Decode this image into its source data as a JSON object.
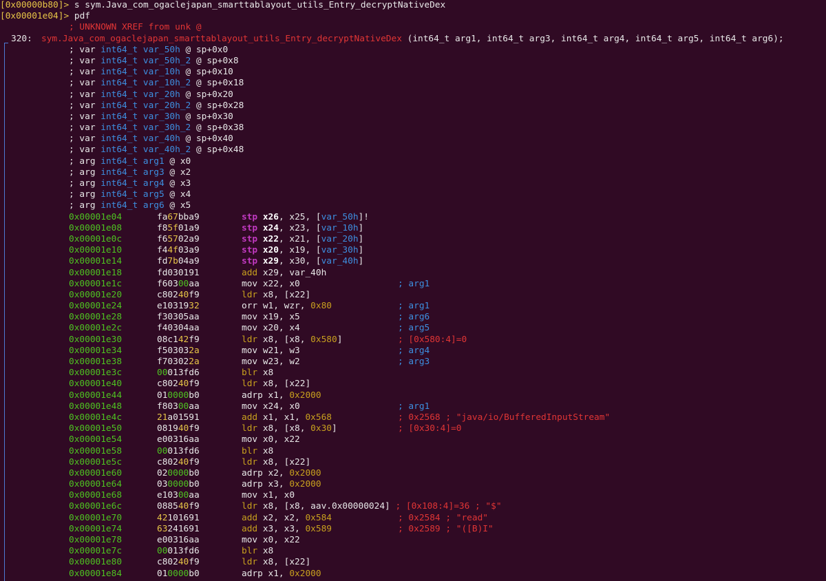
{
  "prompt1": {
    "addr": "[0x00000b80]>",
    "cmd": " s sym.Java_com_ogaclejapan_smarttablayout_utils_Entry_decryptNativeDex"
  },
  "prompt2": {
    "addr": "[0x00001e04]>",
    "cmd": " pdf"
  },
  "xref": "; UNKNOWN XREF from unk @",
  "func": {
    "size": "320:",
    "name": "sym.Java_com_ogaclejapan_smarttablayout_utils_Entry_decryptNativeDex",
    "sig": " (int64_t arg1, int64_t arg3, int64_t arg4, int64_t arg5, int64_t arg6);"
  },
  "vars": [
    {
      "kind": "; var ",
      "type": "int64_t",
      "name": "var_50h",
      "loc": "sp+0x0"
    },
    {
      "kind": "; var ",
      "type": "int64_t",
      "name": "var_50h_2",
      "loc": "sp+0x8"
    },
    {
      "kind": "; var ",
      "type": "int64_t",
      "name": "var_10h",
      "loc": "sp+0x10"
    },
    {
      "kind": "; var ",
      "type": "int64_t",
      "name": "var_10h_2",
      "loc": "sp+0x18"
    },
    {
      "kind": "; var ",
      "type": "int64_t",
      "name": "var_20h",
      "loc": "sp+0x20"
    },
    {
      "kind": "; var ",
      "type": "int64_t",
      "name": "var_20h_2",
      "loc": "sp+0x28"
    },
    {
      "kind": "; var ",
      "type": "int64_t",
      "name": "var_30h",
      "loc": "sp+0x30"
    },
    {
      "kind": "; var ",
      "type": "int64_t",
      "name": "var_30h_2",
      "loc": "sp+0x38"
    },
    {
      "kind": "; var ",
      "type": "int64_t",
      "name": "var_40h",
      "loc": "sp+0x40"
    },
    {
      "kind": "; var ",
      "type": "int64_t",
      "name": "var_40h_2",
      "loc": "sp+0x48"
    },
    {
      "kind": "; arg ",
      "type": "int64_t",
      "name": "arg1",
      "loc": "x0"
    },
    {
      "kind": "; arg ",
      "type": "int64_t",
      "name": "arg3",
      "loc": "x2"
    },
    {
      "kind": "; arg ",
      "type": "int64_t",
      "name": "arg4",
      "loc": "x3"
    },
    {
      "kind": "; arg ",
      "type": "int64_t",
      "name": "arg5",
      "loc": "x4"
    },
    {
      "kind": "; arg ",
      "type": "int64_t",
      "name": "arg6",
      "loc": "x5"
    }
  ],
  "instrs": [
    {
      "addr": "0x00001e04",
      "hex": [
        [
          "fa",
          "w"
        ],
        [
          "67",
          "y"
        ],
        [
          "bba9",
          "w"
        ]
      ],
      "ins": [
        [
          "stp ",
          "mag"
        ],
        [
          "x26",
          "bw"
        ],
        [
          ", x25, [",
          "w"
        ],
        [
          "var_50h",
          "blue"
        ],
        [
          "]!",
          "w"
        ]
      ],
      "cmt": []
    },
    {
      "addr": "0x00001e08",
      "hex": [
        [
          "f8",
          "w"
        ],
        [
          "5f",
          "y"
        ],
        [
          "01a9",
          "w"
        ]
      ],
      "ins": [
        [
          "stp ",
          "mag"
        ],
        [
          "x24",
          "bw"
        ],
        [
          ", x23, [",
          "w"
        ],
        [
          "var_10h",
          "blue"
        ],
        [
          "]",
          "w"
        ]
      ],
      "cmt": []
    },
    {
      "addr": "0x00001e0c",
      "hex": [
        [
          "f6",
          "w"
        ],
        [
          "57",
          "y"
        ],
        [
          "02a9",
          "w"
        ]
      ],
      "ins": [
        [
          "stp ",
          "mag"
        ],
        [
          "x22",
          "bw"
        ],
        [
          ", x21, [",
          "w"
        ],
        [
          "var_20h",
          "blue"
        ],
        [
          "]",
          "w"
        ]
      ],
      "cmt": []
    },
    {
      "addr": "0x00001e10",
      "hex": [
        [
          "f4",
          "w"
        ],
        [
          "4f",
          "y"
        ],
        [
          "03a9",
          "w"
        ]
      ],
      "ins": [
        [
          "stp ",
          "mag"
        ],
        [
          "x20",
          "bw"
        ],
        [
          ", x19, [",
          "w"
        ],
        [
          "var_30h",
          "blue"
        ],
        [
          "]",
          "w"
        ]
      ],
      "cmt": []
    },
    {
      "addr": "0x00001e14",
      "hex": [
        [
          "fd",
          "w"
        ],
        [
          "7b",
          "y"
        ],
        [
          "04a9",
          "w"
        ]
      ],
      "ins": [
        [
          "stp ",
          "mag"
        ],
        [
          "x29",
          "bw"
        ],
        [
          ", x30, [",
          "w"
        ],
        [
          "var_40h",
          "blue"
        ],
        [
          "]",
          "w"
        ]
      ],
      "cmt": []
    },
    {
      "addr": "0x00001e18",
      "hex": [
        [
          "fd030191",
          "w"
        ]
      ],
      "ins": [
        [
          "add",
          "org"
        ],
        [
          " x29, var_40h",
          "w"
        ]
      ],
      "cmt": []
    },
    {
      "addr": "0x00001e1c",
      "hex": [
        [
          "f603",
          "w"
        ],
        [
          "00",
          "grn"
        ],
        [
          "aa",
          "w"
        ]
      ],
      "ins": [
        [
          "mov x22, x0",
          "w"
        ]
      ],
      "cmt": [
        [
          "; arg1",
          "blue"
        ]
      ]
    },
    {
      "addr": "0x00001e20",
      "hex": [
        [
          "c802",
          "w"
        ],
        [
          "40",
          "y"
        ],
        [
          "f9",
          "w"
        ]
      ],
      "ins": [
        [
          "ldr",
          "org"
        ],
        [
          " x8, [x22]",
          "w"
        ]
      ],
      "cmt": []
    },
    {
      "addr": "0x00001e24",
      "hex": [
        [
          "e10319",
          "w"
        ],
        [
          "32",
          "y"
        ]
      ],
      "ins": [
        [
          "orr w1, wzr, ",
          "w"
        ],
        [
          "0x80",
          "org"
        ]
      ],
      "cmt": [
        [
          "; arg1",
          "blue"
        ]
      ]
    },
    {
      "addr": "0x00001e28",
      "hex": [
        [
          "f30305aa",
          "w"
        ]
      ],
      "ins": [
        [
          "mov x19, x5",
          "w"
        ]
      ],
      "cmt": [
        [
          "; arg6",
          "blue"
        ]
      ]
    },
    {
      "addr": "0x00001e2c",
      "hex": [
        [
          "f40304aa",
          "w"
        ]
      ],
      "ins": [
        [
          "mov x20, x4",
          "w"
        ]
      ],
      "cmt": [
        [
          "; arg5",
          "blue"
        ]
      ]
    },
    {
      "addr": "0x00001e30",
      "hex": [
        [
          "08c1",
          "w"
        ],
        [
          "42",
          "y"
        ],
        [
          "f9",
          "w"
        ]
      ],
      "ins": [
        [
          "ldr",
          "org"
        ],
        [
          " x8, [x8, ",
          "w"
        ],
        [
          "0x580",
          "org"
        ],
        [
          "]",
          "w"
        ]
      ],
      "cmt": [
        [
          "; [0x580:4]=0",
          "red"
        ]
      ]
    },
    {
      "addr": "0x00001e34",
      "hex": [
        [
          "f50303",
          "w"
        ],
        [
          "2a",
          "y"
        ]
      ],
      "ins": [
        [
          "mov w21, w3",
          "w"
        ]
      ],
      "cmt": [
        [
          "; arg4",
          "blue"
        ]
      ]
    },
    {
      "addr": "0x00001e38",
      "hex": [
        [
          "f70302",
          "w"
        ],
        [
          "2a",
          "y"
        ]
      ],
      "ins": [
        [
          "mov w23, w2",
          "w"
        ]
      ],
      "cmt": [
        [
          "; arg3",
          "blue"
        ]
      ]
    },
    {
      "addr": "0x00001e3c",
      "hex": [
        [
          "00",
          "grn"
        ],
        [
          "013fd6",
          "w"
        ]
      ],
      "ins": [
        [
          "blr",
          "org"
        ],
        [
          " x8",
          "w"
        ]
      ],
      "cmt": []
    },
    {
      "addr": "0x00001e40",
      "hex": [
        [
          "c802",
          "w"
        ],
        [
          "40",
          "y"
        ],
        [
          "f9",
          "w"
        ]
      ],
      "ins": [
        [
          "ldr",
          "org"
        ],
        [
          " x8, [x22]",
          "w"
        ]
      ],
      "cmt": []
    },
    {
      "addr": "0x00001e44",
      "hex": [
        [
          "01",
          "w"
        ],
        [
          "0000",
          "grn"
        ],
        [
          "b0",
          "w"
        ]
      ],
      "ins": [
        [
          "adrp x1, ",
          "w"
        ],
        [
          "0x2000",
          "org"
        ]
      ],
      "cmt": []
    },
    {
      "addr": "0x00001e48",
      "hex": [
        [
          "f803",
          "w"
        ],
        [
          "00",
          "grn"
        ],
        [
          "aa",
          "w"
        ]
      ],
      "ins": [
        [
          "mov x24, x0",
          "w"
        ]
      ],
      "cmt": [
        [
          "; arg1",
          "blue"
        ]
      ]
    },
    {
      "addr": "0x00001e4c",
      "hex": [
        [
          "21",
          "y"
        ],
        [
          "a01591",
          "w"
        ]
      ],
      "ins": [
        [
          "add",
          "org"
        ],
        [
          " x1, x1, ",
          "w"
        ],
        [
          "0x568",
          "org"
        ]
      ],
      "cmt": [
        [
          "; 0x2568 ; \"java/io/BufferedInputStream\"",
          "red"
        ]
      ]
    },
    {
      "addr": "0x00001e50",
      "hex": [
        [
          "0819",
          "w"
        ],
        [
          "40",
          "y"
        ],
        [
          "f9",
          "w"
        ]
      ],
      "ins": [
        [
          "ldr",
          "org"
        ],
        [
          " x8, [x8, ",
          "w"
        ],
        [
          "0x30",
          "org"
        ],
        [
          "]",
          "w"
        ]
      ],
      "cmt": [
        [
          "; [0x30:4]=0",
          "red"
        ]
      ]
    },
    {
      "addr": "0x00001e54",
      "hex": [
        [
          "e00316aa",
          "w"
        ]
      ],
      "ins": [
        [
          "mov x0, x22",
          "w"
        ]
      ],
      "cmt": []
    },
    {
      "addr": "0x00001e58",
      "hex": [
        [
          "00",
          "grn"
        ],
        [
          "013fd6",
          "w"
        ]
      ],
      "ins": [
        [
          "blr",
          "org"
        ],
        [
          " x8",
          "w"
        ]
      ],
      "cmt": []
    },
    {
      "addr": "0x00001e5c",
      "hex": [
        [
          "c802",
          "w"
        ],
        [
          "40",
          "y"
        ],
        [
          "f9",
          "w"
        ]
      ],
      "ins": [
        [
          "ldr",
          "org"
        ],
        [
          " x8, [x22]",
          "w"
        ]
      ],
      "cmt": []
    },
    {
      "addr": "0x00001e60",
      "hex": [
        [
          "02",
          "w"
        ],
        [
          "0000",
          "grn"
        ],
        [
          "b0",
          "w"
        ]
      ],
      "ins": [
        [
          "adrp x2, ",
          "w"
        ],
        [
          "0x2000",
          "org"
        ]
      ],
      "cmt": []
    },
    {
      "addr": "0x00001e64",
      "hex": [
        [
          "03",
          "w"
        ],
        [
          "0000",
          "grn"
        ],
        [
          "b0",
          "w"
        ]
      ],
      "ins": [
        [
          "adrp x3, ",
          "w"
        ],
        [
          "0x2000",
          "org"
        ]
      ],
      "cmt": []
    },
    {
      "addr": "0x00001e68",
      "hex": [
        [
          "e103",
          "w"
        ],
        [
          "00",
          "grn"
        ],
        [
          "aa",
          "w"
        ]
      ],
      "ins": [
        [
          "mov x1, x0",
          "w"
        ]
      ],
      "cmt": []
    },
    {
      "addr": "0x00001e6c",
      "hex": [
        [
          "0885",
          "w"
        ],
        [
          "40",
          "y"
        ],
        [
          "f9",
          "w"
        ]
      ],
      "ins": [
        [
          "ldr",
          "org"
        ],
        [
          " x8, [x8, aav.0x00000024] ",
          "w"
        ],
        [
          "; [0x108:4]=36 ; \"$\"",
          "red"
        ]
      ],
      "cmt": []
    },
    {
      "addr": "0x00001e70",
      "hex": [
        [
          "42",
          "y"
        ],
        [
          "101691",
          "w"
        ]
      ],
      "ins": [
        [
          "add",
          "org"
        ],
        [
          " x2, x2, ",
          "w"
        ],
        [
          "0x584",
          "org"
        ]
      ],
      "cmt": [
        [
          "; 0x2584 ; \"read\"",
          "red"
        ]
      ]
    },
    {
      "addr": "0x00001e74",
      "hex": [
        [
          "63",
          "y"
        ],
        [
          "241691",
          "w"
        ]
      ],
      "ins": [
        [
          "add",
          "org"
        ],
        [
          " x3, x3, ",
          "w"
        ],
        [
          "0x589",
          "org"
        ]
      ],
      "cmt": [
        [
          "; 0x2589 ; \"([B)I\"",
          "red"
        ]
      ]
    },
    {
      "addr": "0x00001e78",
      "hex": [
        [
          "e00316aa",
          "w"
        ]
      ],
      "ins": [
        [
          "mov x0, x22",
          "w"
        ]
      ],
      "cmt": []
    },
    {
      "addr": "0x00001e7c",
      "hex": [
        [
          "00",
          "grn"
        ],
        [
          "013fd6",
          "w"
        ]
      ],
      "ins": [
        [
          "blr",
          "org"
        ],
        [
          " x8",
          "w"
        ]
      ],
      "cmt": []
    },
    {
      "addr": "0x00001e80",
      "hex": [
        [
          "c802",
          "w"
        ],
        [
          "40",
          "y"
        ],
        [
          "f9",
          "w"
        ]
      ],
      "ins": [
        [
          "ldr",
          "org"
        ],
        [
          " x8, [x22]",
          "w"
        ]
      ],
      "cmt": []
    },
    {
      "addr": "0x00001e84",
      "hex": [
        [
          "01",
          "w"
        ],
        [
          "0000",
          "grn"
        ],
        [
          "b0",
          "w"
        ]
      ],
      "ins": [
        [
          "adrp x1, ",
          "w"
        ],
        [
          "0x2000",
          "org"
        ]
      ],
      "cmt": []
    }
  ]
}
